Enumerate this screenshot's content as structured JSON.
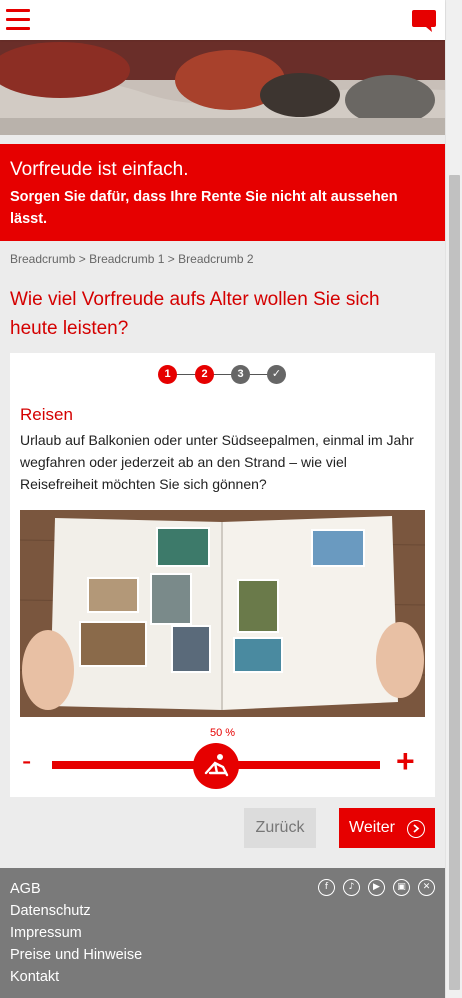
{
  "header": {
    "menu_icon": "hamburger-icon",
    "chat_icon": "chat-bubble-icon"
  },
  "banner": {
    "title": "Vorfreude ist einfach.",
    "subtitle": "Sorgen Sie dafür, dass Ihre Rente Sie nicht alt aussehen lässt."
  },
  "breadcrumb": {
    "items": [
      "Breadcrumb",
      "Breadcrumb 1",
      "Breadcrumb 2"
    ],
    "separator": ">"
  },
  "question": "Wie viel Vorfreude aufs Alter wollen Sie sich heute leisten?",
  "stepper": {
    "steps": [
      "1",
      "2",
      "3",
      "✓"
    ],
    "active_step": 2
  },
  "card": {
    "heading": "Reisen",
    "description": "Urlaub auf Balkonien oder unter Südseepalmen, einmal im Jahr wegfahren oder jederzeit ab an den Strand – wie viel Reisefreiheit möchten Sie sich gönnen?"
  },
  "slider": {
    "value_label": "50 %",
    "value": 50,
    "minus": "-",
    "plus": "+",
    "knob_icon": "beach-chair-icon"
  },
  "buttons": {
    "back": "Zurück",
    "next": "Weiter"
  },
  "footer": {
    "links": [
      "AGB",
      "Datenschutz",
      "Impressum",
      "Preise und Hinweise",
      "Kontakt"
    ],
    "social": [
      "facebook-icon",
      "twitter-icon",
      "youtube-icon",
      "instagram-icon",
      "xing-icon"
    ]
  },
  "colors": {
    "brand_red": "#e60000",
    "footer_grey": "#7a7a7a"
  }
}
